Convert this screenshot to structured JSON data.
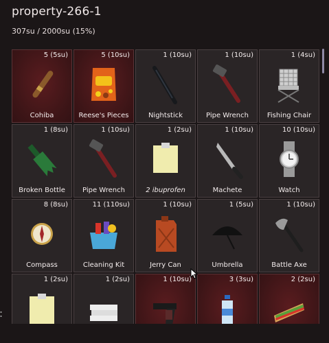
{
  "inventory": {
    "title": "property-266-1",
    "capacity": "307su / 2000su (15%)",
    "items": [
      {
        "count": "5 (5su)",
        "label": "Cohiba",
        "icon": "cigar-icon",
        "highlight": true
      },
      {
        "count": "5 (10su)",
        "label": "Reese's Pieces",
        "icon": "candy-bag-icon",
        "highlight": true
      },
      {
        "count": "1 (10su)",
        "label": "Nightstick",
        "icon": "nightstick-icon",
        "highlight": false
      },
      {
        "count": "1 (10su)",
        "label": "Pipe Wrench",
        "icon": "pipe-wrench-icon",
        "highlight": false
      },
      {
        "count": "1 (4su)",
        "label": "Fishing Chair",
        "icon": "fishing-chair-icon",
        "highlight": false
      },
      {
        "count": "1 (8su)",
        "label": "Broken Bottle",
        "icon": "broken-bottle-icon",
        "highlight": false
      },
      {
        "count": "1 (10su)",
        "label": "Pipe Wrench",
        "icon": "pipe-wrench-icon",
        "highlight": false
      },
      {
        "count": "1 (2su)",
        "label": "2 ibuprofen",
        "icon": "note-icon",
        "highlight": false
      },
      {
        "count": "1 (10su)",
        "label": "Machete",
        "icon": "machete-icon",
        "highlight": false
      },
      {
        "count": "10 (10su)",
        "label": "Watch",
        "icon": "watch-icon",
        "highlight": false
      },
      {
        "count": "8 (8su)",
        "label": "Compass",
        "icon": "compass-icon",
        "highlight": false
      },
      {
        "count": "11 (110su)",
        "label": "Cleaning Kit",
        "icon": "cleaning-kit-icon",
        "highlight": false
      },
      {
        "count": "1 (10su)",
        "label": "Jerry Can",
        "icon": "jerry-can-icon",
        "highlight": false
      },
      {
        "count": "1 (5su)",
        "label": "Umbrella",
        "icon": "umbrella-icon",
        "highlight": false
      },
      {
        "count": "1 (10su)",
        "label": "Battle Axe",
        "icon": "battle-axe-icon",
        "highlight": false
      },
      {
        "count": "1 (2su)",
        "label": "",
        "icon": "note-icon",
        "highlight": false
      },
      {
        "count": "1 (2su)",
        "label": "",
        "icon": "towels-icon",
        "highlight": false
      },
      {
        "count": "1 (10su)",
        "label": "",
        "icon": "pistol-icon",
        "highlight": true
      },
      {
        "count": "3 (3su)",
        "label": "",
        "icon": "water-bottle-icon",
        "highlight": true
      },
      {
        "count": "2 (2su)",
        "label": "",
        "icon": "sandwich-icon",
        "highlight": true
      }
    ]
  }
}
